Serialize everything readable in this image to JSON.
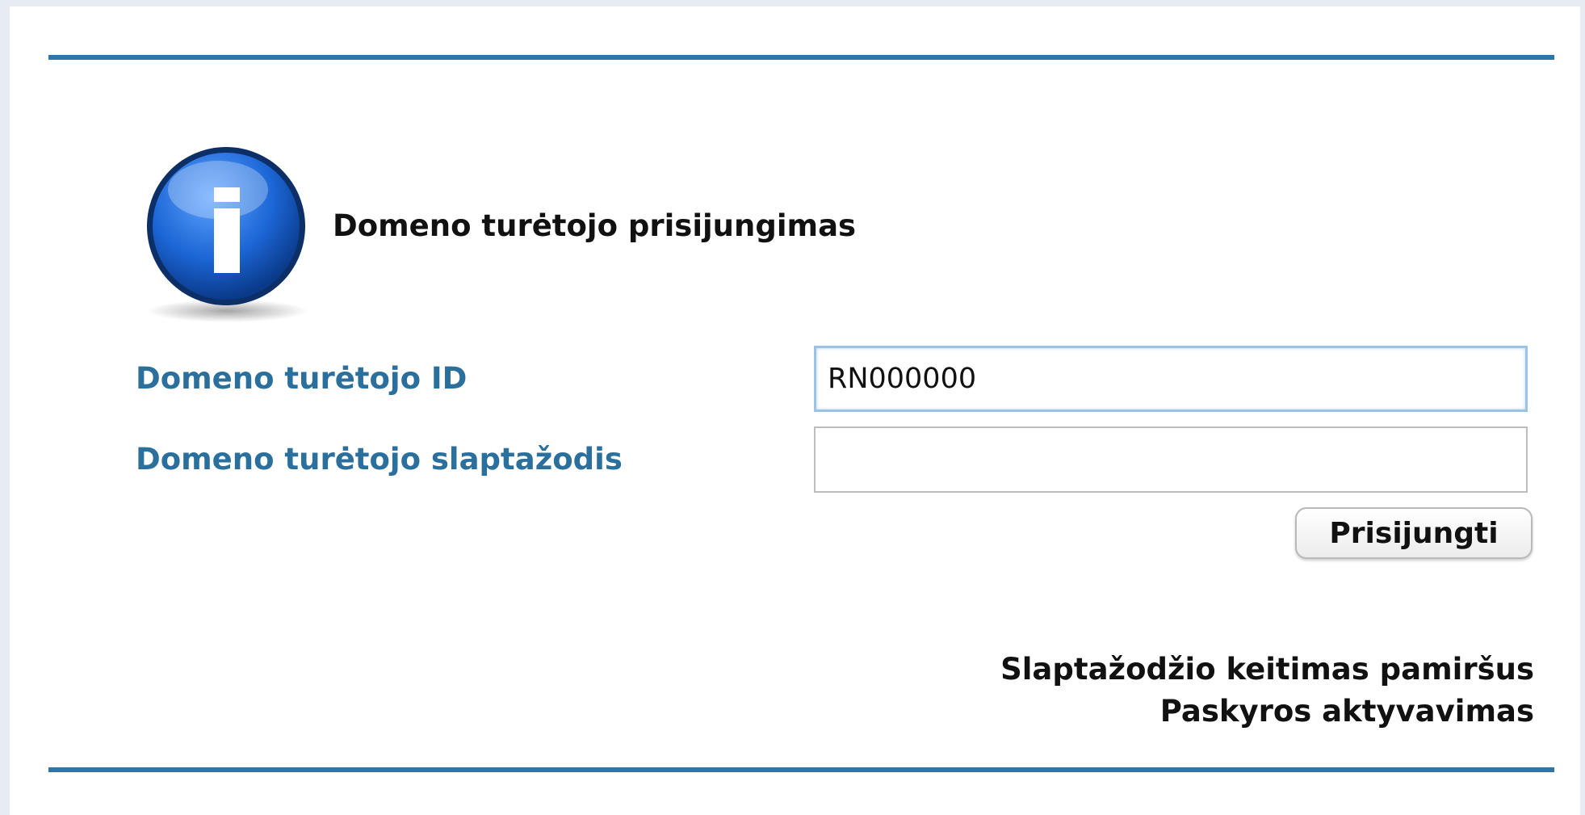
{
  "form": {
    "title": "Domeno turėtojo prisijungimas",
    "icon": "info-icon",
    "id_label": "Domeno turėtojo ID",
    "id_value": "RN000000",
    "password_label": "Domeno turėtojo slaptažodis",
    "password_value": "",
    "submit_label": "Prisijungti"
  },
  "links": {
    "forgot_password": "Slaptažodžio keitimas pamiršus",
    "activate_account": "Paskyros aktyvavimas"
  },
  "colors": {
    "accent": "#2d76a6",
    "label": "#2b6f9c",
    "icon_blue": "#1a63c9"
  }
}
